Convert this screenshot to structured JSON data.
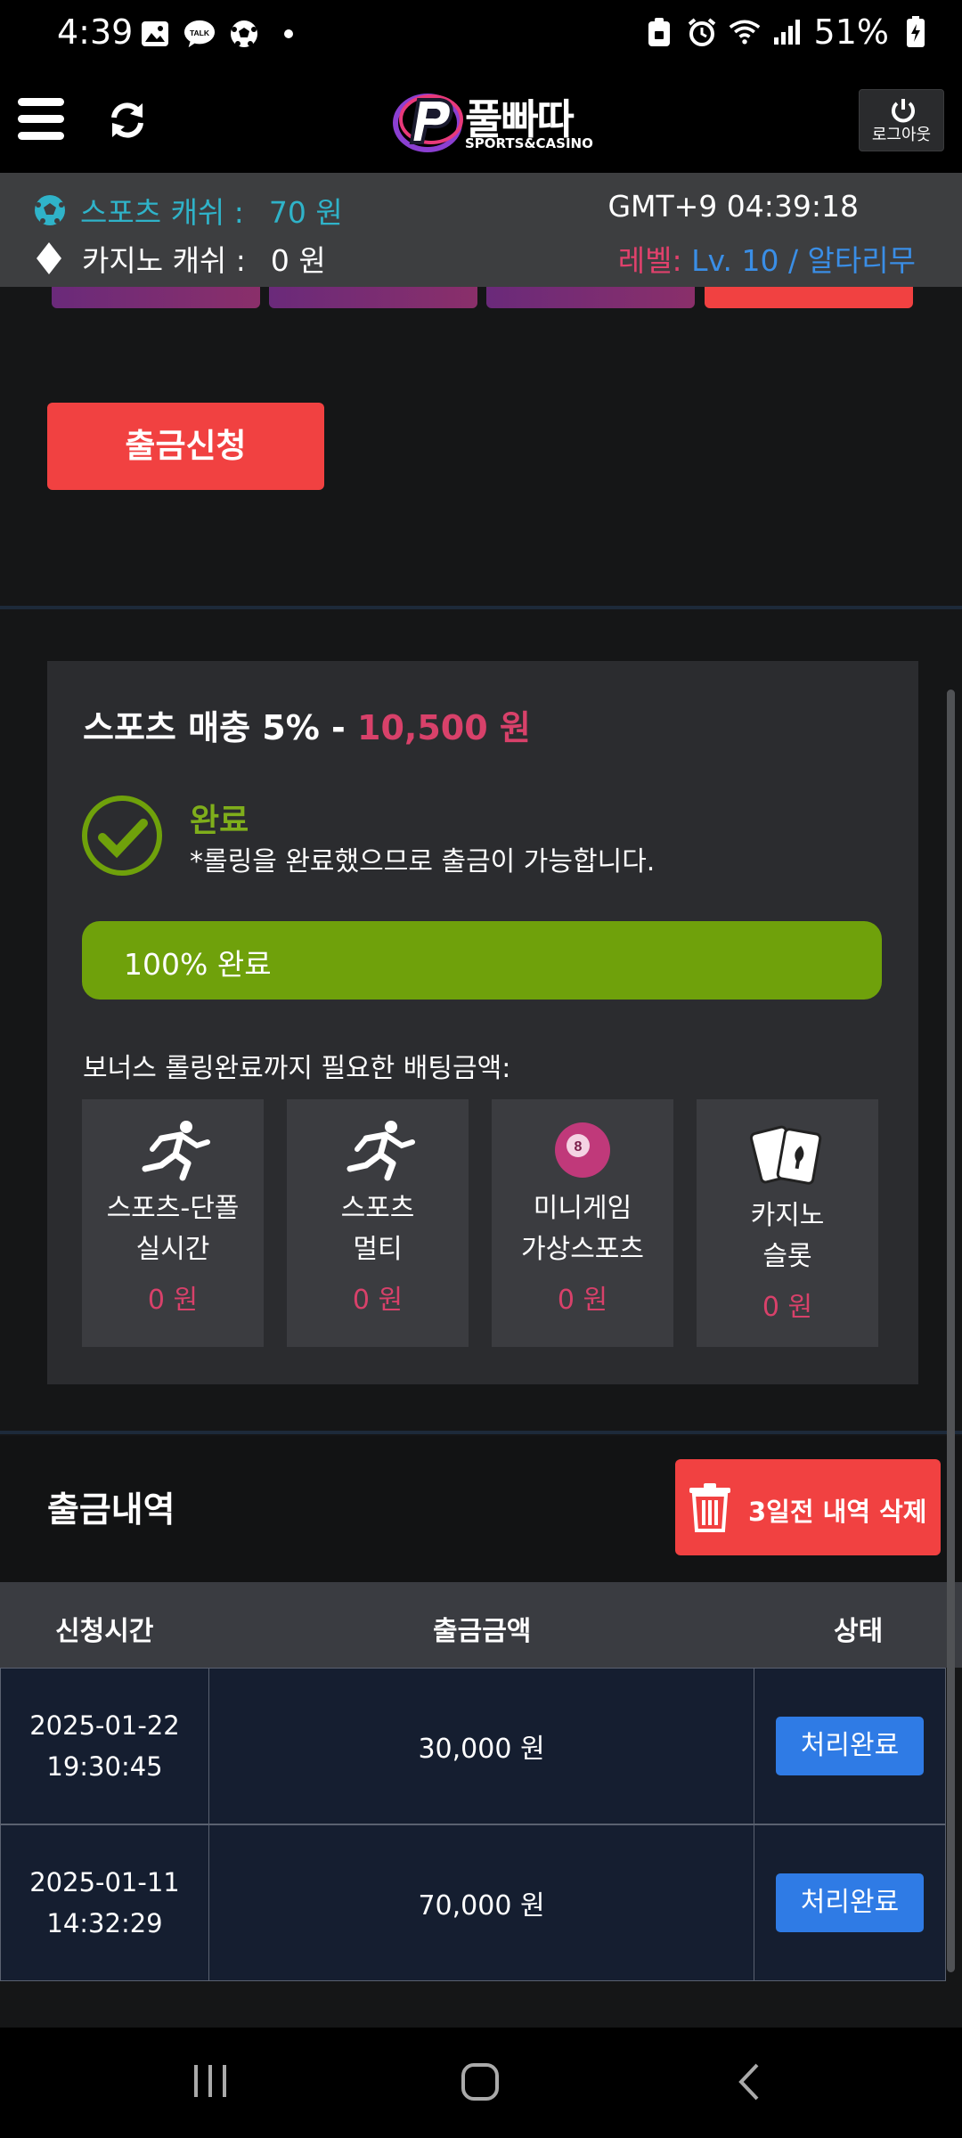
{
  "status_bar": {
    "time": "4:39",
    "battery": "51%"
  },
  "header": {
    "logo_title": "풀빠따",
    "logo_sub": "SPORTS&CASINO",
    "logout_label": "로그아웃"
  },
  "info": {
    "sports_label": "스포츠 캐쉬 :",
    "sports_value": "70 원",
    "casino_label": "카지노 캐쉬 :",
    "casino_value": "0 원",
    "clock": "GMT+9 04:39:18",
    "level_label": "레벨:",
    "level_value": "Lv. 10 / 알타리무"
  },
  "withdraw_button": "출금신청",
  "rolling": {
    "title": "스포츠 매충 5% - ",
    "amount": "10,500 원",
    "status": "완료",
    "status_desc": "*롤링을 완료했으므로 출금이 가능합니다.",
    "progress_label": "100% 완료",
    "progress_percent": 100,
    "need_label": "보너스 롤링완료까지 필요한 배팅금액:",
    "cards": [
      {
        "icon": "runner-icon",
        "line1": "스포츠-단폴",
        "line2": "실시간",
        "amount": "0 원"
      },
      {
        "icon": "runner-icon",
        "line1": "스포츠",
        "line2": "멀티",
        "amount": "0 원"
      },
      {
        "icon": "billiard-ball-icon",
        "line1": "미니게임",
        "line2": "가상스포츠",
        "amount": "0 원"
      },
      {
        "icon": "playing-cards-icon",
        "line1": "카지노",
        "line2": "슬롯",
        "amount": "0 원"
      }
    ]
  },
  "history": {
    "title": "출금내역",
    "delete_label": "3일전 내역 삭제",
    "columns": [
      "신청시간",
      "출금금액",
      "상태"
    ],
    "rows": [
      {
        "date": "2025-01-22",
        "time": "19:30:45",
        "amount": "30,000 원",
        "status": "처리완료"
      },
      {
        "date": "2025-01-11",
        "time": "14:32:29",
        "amount": "70,000 원",
        "status": "처리완료"
      }
    ]
  },
  "colors": {
    "accent_red": "#f14141",
    "progress_green": "#6fa10b",
    "amount_pink": "#d8416a",
    "status_blue": "#2f7be5"
  }
}
